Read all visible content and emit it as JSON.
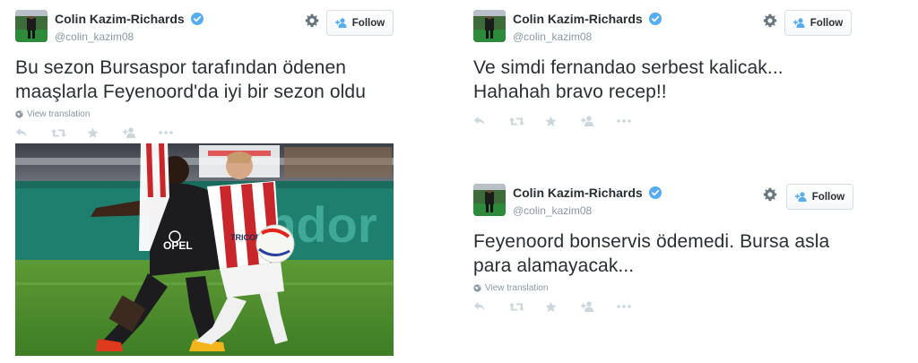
{
  "tweets": [
    {
      "name": "Colin Kazim-Richards",
      "handle": "@colin_kazim08",
      "text_lines": [
        "Bu sezon Bursaspor tarafından ödenen",
        "maaşlarla Feyenoord'da iyi bir sezon oldu"
      ],
      "translate_label": "View translation",
      "follow_label": "Follow",
      "has_photo": true
    },
    {
      "name": "Colin Kazim-Richards",
      "handle": "@colin_kazim08",
      "text_lines": [
        "Ve simdi fernandao serbest kalicak...",
        "Hahahah bravo recep!!"
      ],
      "follow_label": "Follow"
    },
    {
      "name": "Colin Kazim-Richards",
      "handle": "@colin_kazim08",
      "text_lines": [
        "Feyenoord bonservis ödemedi. Bursa asla",
        "para alamayacak..."
      ],
      "translate_label": "View translation",
      "follow_label": "Follow"
    }
  ],
  "photo": {
    "sponsor_text": "ondor",
    "jersey_text_left": "OPEL",
    "jersey_text_right": "TRICOR"
  },
  "colors": {
    "verified": "#55acee",
    "muted": "#8899a6",
    "text": "#292f33",
    "follow_icon": "#55acee"
  },
  "icons": [
    "gear-icon",
    "verified-icon",
    "follow-person-icon",
    "globe-icon",
    "reply-icon",
    "retweet-icon",
    "favorite-icon",
    "follow-action-icon",
    "more-icon"
  ]
}
